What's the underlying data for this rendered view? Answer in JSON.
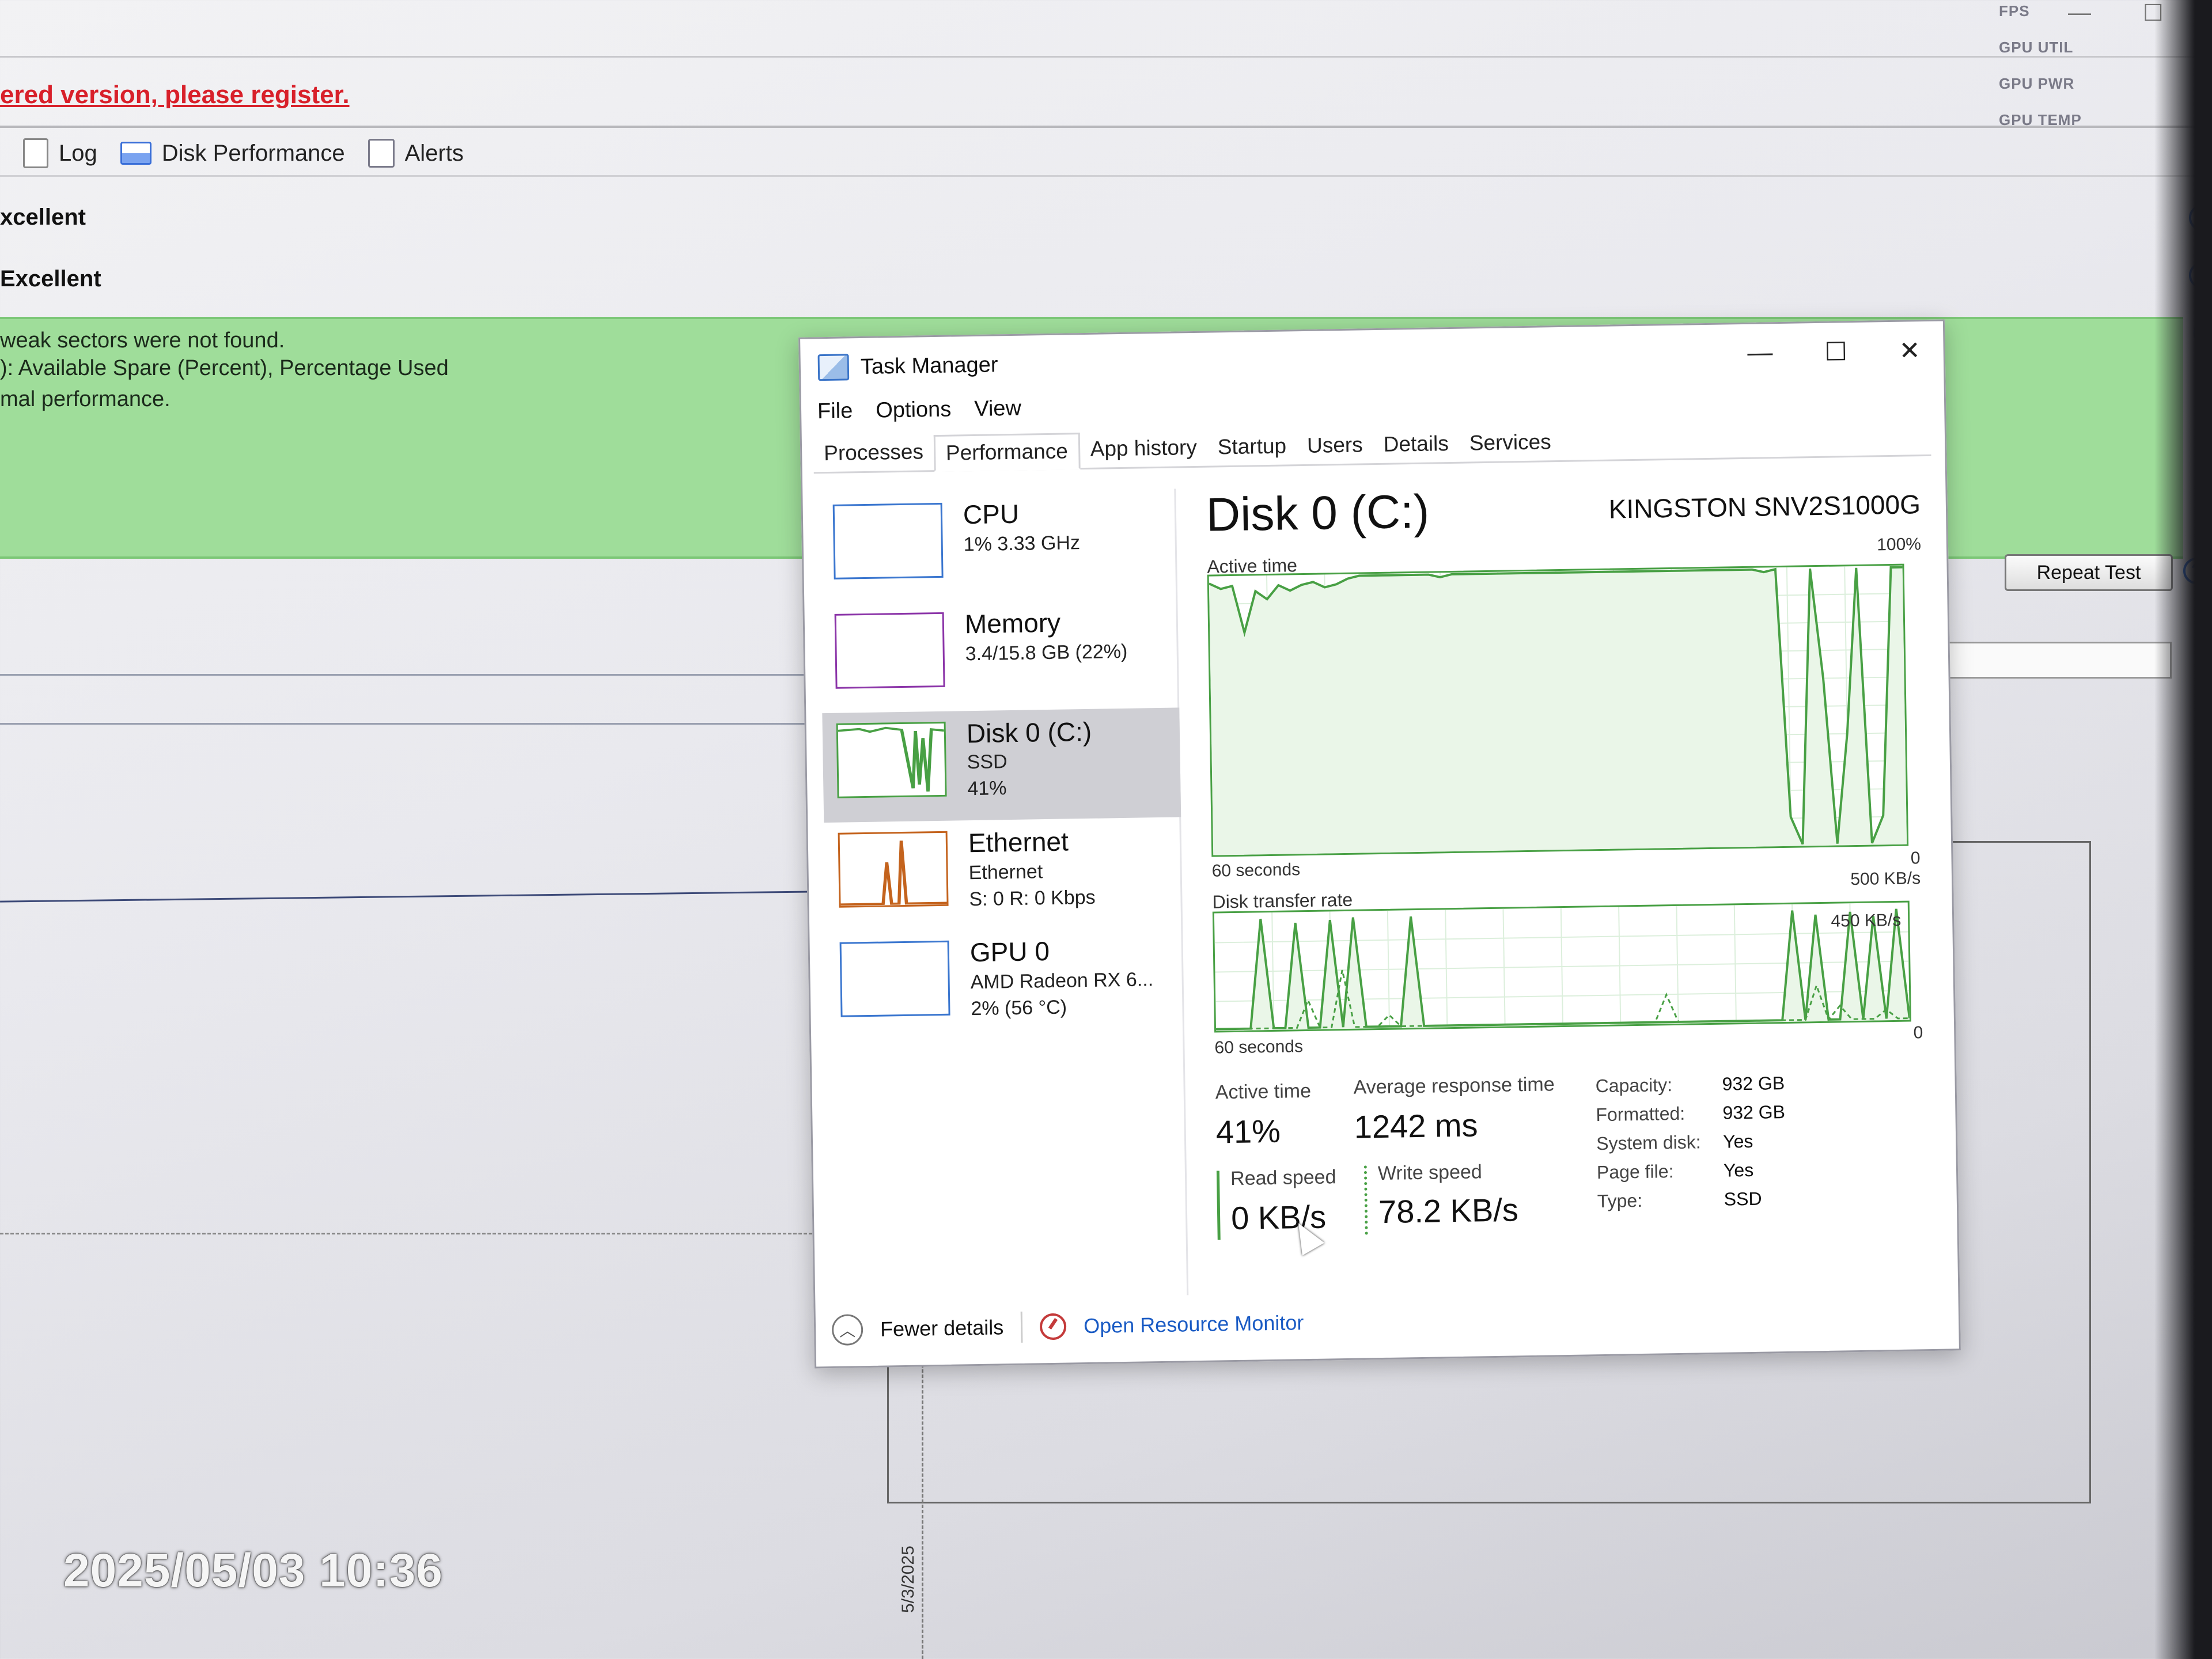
{
  "background_app": {
    "register_text": "ered version, please register.",
    "toolbar": [
      {
        "label": "Log",
        "icon": "document-icon"
      },
      {
        "label": "Disk Performance",
        "icon": "chart-icon"
      },
      {
        "label": "Alerts",
        "icon": "alerts-icon"
      }
    ],
    "ratings": [
      "xcellent",
      "Excellent"
    ],
    "status_lines": [
      "weak sectors were not found.",
      "):  Available Spare (Percent), Percentage Used",
      "mal performance."
    ],
    "repeat_button": "Repeat Test",
    "help_glyph": "?",
    "gpu_overlay_labels": [
      "FPS",
      "GPU UTIL",
      "GPU PWR",
      "GPU TEMP"
    ],
    "chart_date": "5/3/2025"
  },
  "timestamp": "2025/05/03 10:36",
  "task_manager": {
    "title": "Task Manager",
    "window_controls": {
      "minimize": "—",
      "maximize": "☐",
      "close": "✕"
    },
    "menu": [
      "File",
      "Options",
      "View"
    ],
    "tabs": [
      "Processes",
      "Performance",
      "App history",
      "Startup",
      "Users",
      "Details",
      "Services"
    ],
    "active_tab": "Performance",
    "sidebar": [
      {
        "name": "CPU",
        "lines": [
          "1% 3.33 GHz"
        ]
      },
      {
        "name": "Memory",
        "lines": [
          "3.4/15.8 GB (22%)"
        ]
      },
      {
        "name": "Disk 0 (C:)",
        "lines": [
          "SSD",
          "41%"
        ]
      },
      {
        "name": "Ethernet",
        "lines": [
          "Ethernet",
          "S: 0 R: 0 Kbps"
        ]
      },
      {
        "name": "GPU 0",
        "lines": [
          "AMD Radeon RX 6...",
          "2% (56 °C)"
        ]
      }
    ],
    "selected_sidebar": "Disk 0 (C:)",
    "main": {
      "title": "Disk 0 (C:)",
      "model": "KINGSTON SNV2S1000G",
      "active_chart": {
        "label": "Active time",
        "max_label": "100%",
        "min_label": "0",
        "time_label": "60 seconds"
      },
      "transfer_chart": {
        "label": "Disk transfer rate",
        "max_label": "500 KB/s",
        "mid_label": "450 KB/s",
        "min_label": "0",
        "time_label": "60 seconds"
      },
      "stats": {
        "active_time_label": "Active time",
        "active_time_value": "41%",
        "avg_response_label": "Average response time",
        "avg_response_value": "1242 ms",
        "read_label": "Read speed",
        "read_value": "0 KB/s",
        "write_label": "Write speed",
        "write_value": "78.2 KB/s"
      },
      "properties": [
        {
          "key": "Capacity:",
          "value": "932 GB"
        },
        {
          "key": "Formatted:",
          "value": "932 GB"
        },
        {
          "key": "System disk:",
          "value": "Yes"
        },
        {
          "key": "Page file:",
          "value": "Yes"
        },
        {
          "key": "Type:",
          "value": "SSD"
        }
      ]
    },
    "footer": {
      "fewer_details": "Fewer details",
      "resource_monitor": "Open Resource Monitor"
    },
    "colors": {
      "disk": "#48a044",
      "cpu": "#3a76cf",
      "memory": "#8b34a8",
      "ethernet": "#c4631d"
    }
  },
  "chart_data": [
    {
      "type": "line",
      "title": "Active time",
      "xlabel": "60 seconds",
      "ylim": [
        0,
        100
      ],
      "x": [
        0,
        1,
        2,
        3,
        4,
        5,
        6,
        7,
        8,
        9,
        10,
        11,
        12,
        13,
        14,
        15,
        16,
        17,
        18,
        19,
        20,
        21,
        22,
        23,
        24,
        25,
        26,
        27,
        28,
        29,
        30,
        31,
        32,
        33,
        34,
        35,
        36,
        37,
        38,
        39,
        40,
        41,
        42,
        43,
        44,
        45,
        46,
        47,
        48,
        49,
        50,
        51,
        52,
        53,
        54,
        55,
        56,
        57,
        58,
        59,
        60
      ],
      "series": [
        {
          "values": [
            98,
            96,
            97,
            80,
            95,
            92,
            97,
            95,
            97,
            98,
            96,
            97,
            99,
            100,
            100,
            100,
            100,
            100,
            100,
            100,
            99,
            100,
            100,
            100,
            100,
            100,
            100,
            100,
            100,
            100,
            100,
            100,
            100,
            100,
            100,
            100,
            100,
            100,
            100,
            100,
            100,
            100,
            100,
            100,
            100,
            100,
            100,
            100,
            99,
            100,
            10,
            0,
            100,
            60,
            0,
            40,
            100,
            0,
            10,
            100,
            100
          ]
        }
      ]
    },
    {
      "type": "line",
      "title": "Disk transfer rate",
      "xlabel": "60 seconds",
      "ylim": [
        0,
        500
      ],
      "x": [
        0,
        1,
        2,
        3,
        4,
        5,
        6,
        7,
        8,
        9,
        10,
        11,
        12,
        13,
        14,
        15,
        16,
        17,
        18,
        19,
        20,
        21,
        22,
        23,
        24,
        25,
        26,
        27,
        28,
        29,
        30,
        31,
        32,
        33,
        34,
        35,
        36,
        37,
        38,
        39,
        40,
        41,
        42,
        43,
        44,
        45,
        46,
        47,
        48,
        49,
        50,
        51,
        52,
        53,
        54,
        55,
        56,
        57,
        58,
        59,
        60
      ],
      "series": [
        {
          "values": [
            0,
            0,
            0,
            0,
            480,
            0,
            0,
            460,
            0,
            0,
            470,
            0,
            480,
            0,
            0,
            0,
            0,
            480,
            0,
            0,
            0,
            0,
            0,
            0,
            0,
            0,
            0,
            0,
            0,
            0,
            0,
            0,
            0,
            0,
            0,
            0,
            0,
            0,
            0,
            0,
            0,
            0,
            0,
            0,
            0,
            0,
            0,
            0,
            0,
            0,
            480,
            0,
            460,
            0,
            0,
            470,
            0,
            450,
            0,
            480,
            0
          ]
        },
        {
          "values": [
            0,
            0,
            0,
            0,
            0,
            0,
            0,
            0,
            120,
            0,
            0,
            250,
            0,
            0,
            0,
            50,
            0,
            0,
            0,
            0,
            0,
            0,
            0,
            0,
            0,
            0,
            0,
            0,
            0,
            0,
            0,
            0,
            0,
            0,
            0,
            0,
            0,
            0,
            0,
            120,
            0,
            0,
            0,
            0,
            0,
            0,
            0,
            0,
            0,
            0,
            0,
            0,
            150,
            0,
            60,
            0,
            0,
            0,
            40,
            0,
            0
          ]
        }
      ]
    }
  ]
}
